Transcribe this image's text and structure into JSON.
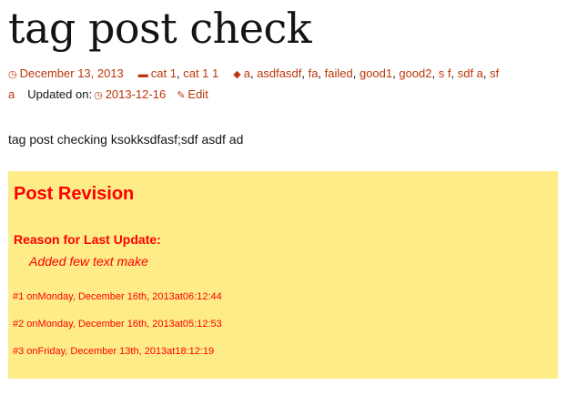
{
  "post": {
    "title": "tag post check",
    "content": "tag post checking ksokksdfasf;sdf asdf ad"
  },
  "meta": {
    "date": "December 13, 2013",
    "categories": [
      "cat 1",
      "cat 1 1"
    ],
    "tags_line1": [
      "a",
      "asdfasdf",
      "fa",
      "failed",
      "good1",
      "good2",
      "s f",
      "sdf a",
      "sf"
    ],
    "tags_line2": [
      "a"
    ],
    "updated_label": "Updated on:",
    "updated_date": "2013-12-16",
    "edit_label": "Edit",
    "icons": {
      "date": "clock-icon",
      "categories": "folder-icon",
      "tags": "tag-icon",
      "updated": "clock-icon",
      "edit": "pencil-icon"
    }
  },
  "revision": {
    "heading": "Post Revision",
    "reason_label": "Reason for Last Update:",
    "reason_text": "Added few text make",
    "entries": [
      "#1 onMonday, December 16th, 2013at06:12:44",
      "#2 onMonday, December 16th, 2013at05:12:53",
      "#3 onFriday, December 13th, 2013at18:12:19"
    ]
  },
  "colors": {
    "link": "#bc360a",
    "revision_bg": "#feec88",
    "revision_text": "#ff0000"
  }
}
